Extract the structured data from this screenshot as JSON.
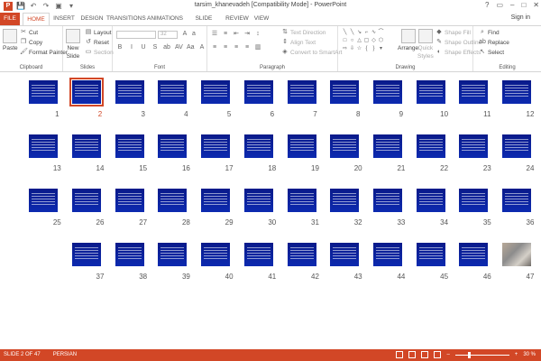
{
  "window": {
    "title": "tarsim_khanevadeh [Compatibility Mode] - PowerPoint",
    "controls": [
      "?",
      "▭",
      "–",
      "□",
      "✕"
    ]
  },
  "qat": {
    "save": "💾",
    "undo": "↶",
    "redo": "↷",
    "start": "▣",
    "customize": "▾"
  },
  "tabs": [
    {
      "label": "FILE"
    },
    {
      "label": "HOME"
    },
    {
      "label": "INSERT"
    },
    {
      "label": "DESIGN"
    },
    {
      "label": "TRANSITIONS"
    },
    {
      "label": "ANIMATIONS"
    },
    {
      "label": "SLIDE SHOW"
    },
    {
      "label": "REVIEW"
    },
    {
      "label": "VIEW"
    }
  ],
  "signin": "Sign in",
  "ribbon": {
    "clipboard": {
      "label": "Clipboard",
      "paste": "Paste",
      "cut": "Cut",
      "copy": "Copy",
      "format_painter": "Format Painter"
    },
    "slides": {
      "label": "Slides",
      "new_slide": "New",
      "new_slide2": "Slide",
      "layout": "Layout",
      "reset": "Reset",
      "section": "Section"
    },
    "font": {
      "label": "Font",
      "size": "32"
    },
    "paragraph": {
      "label": "Paragraph",
      "text_direction": "Text Direction",
      "align_text": "Align Text",
      "convert": "Convert to SmartArt"
    },
    "drawing": {
      "label": "Drawing",
      "arrange": "Arrange",
      "quick_styles": "Quick",
      "quick_styles2": "Styles",
      "shape_fill": "Shape Fill",
      "shape_outline": "Shape Outline",
      "shape_effects": "Shape Effects"
    },
    "editing": {
      "label": "Editing",
      "find": "Find",
      "replace": "Replace",
      "select": "Select"
    }
  },
  "slides": [
    {
      "n": "12"
    },
    {
      "n": "11"
    },
    {
      "n": "10"
    },
    {
      "n": "9"
    },
    {
      "n": "8"
    },
    {
      "n": "7"
    },
    {
      "n": "6"
    },
    {
      "n": "5"
    },
    {
      "n": "4"
    },
    {
      "n": "3"
    },
    {
      "n": "2",
      "selected": true
    },
    {
      "n": "1"
    },
    {
      "n": "24"
    },
    {
      "n": "23"
    },
    {
      "n": "22"
    },
    {
      "n": "21"
    },
    {
      "n": "20"
    },
    {
      "n": "19"
    },
    {
      "n": "18"
    },
    {
      "n": "17"
    },
    {
      "n": "16"
    },
    {
      "n": "15"
    },
    {
      "n": "14"
    },
    {
      "n": "13"
    },
    {
      "n": "36"
    },
    {
      "n": "35"
    },
    {
      "n": "34"
    },
    {
      "n": "33"
    },
    {
      "n": "32"
    },
    {
      "n": "31"
    },
    {
      "n": "30"
    },
    {
      "n": "29"
    },
    {
      "n": "28"
    },
    {
      "n": "27"
    },
    {
      "n": "26"
    },
    {
      "n": "25"
    },
    {
      "n": "47",
      "photo": true
    },
    {
      "n": "46"
    },
    {
      "n": "45"
    },
    {
      "n": "44"
    },
    {
      "n": "43"
    },
    {
      "n": "42"
    },
    {
      "n": "41"
    },
    {
      "n": "40"
    },
    {
      "n": "39"
    },
    {
      "n": "38"
    },
    {
      "n": "37"
    }
  ],
  "status": {
    "slide_count": "SLIDE 2 OF 47",
    "language": "PERSIAN",
    "zoom": "30 %"
  },
  "colors": {
    "accent": "#d24726",
    "slide_bg": "#0c2ab0"
  }
}
